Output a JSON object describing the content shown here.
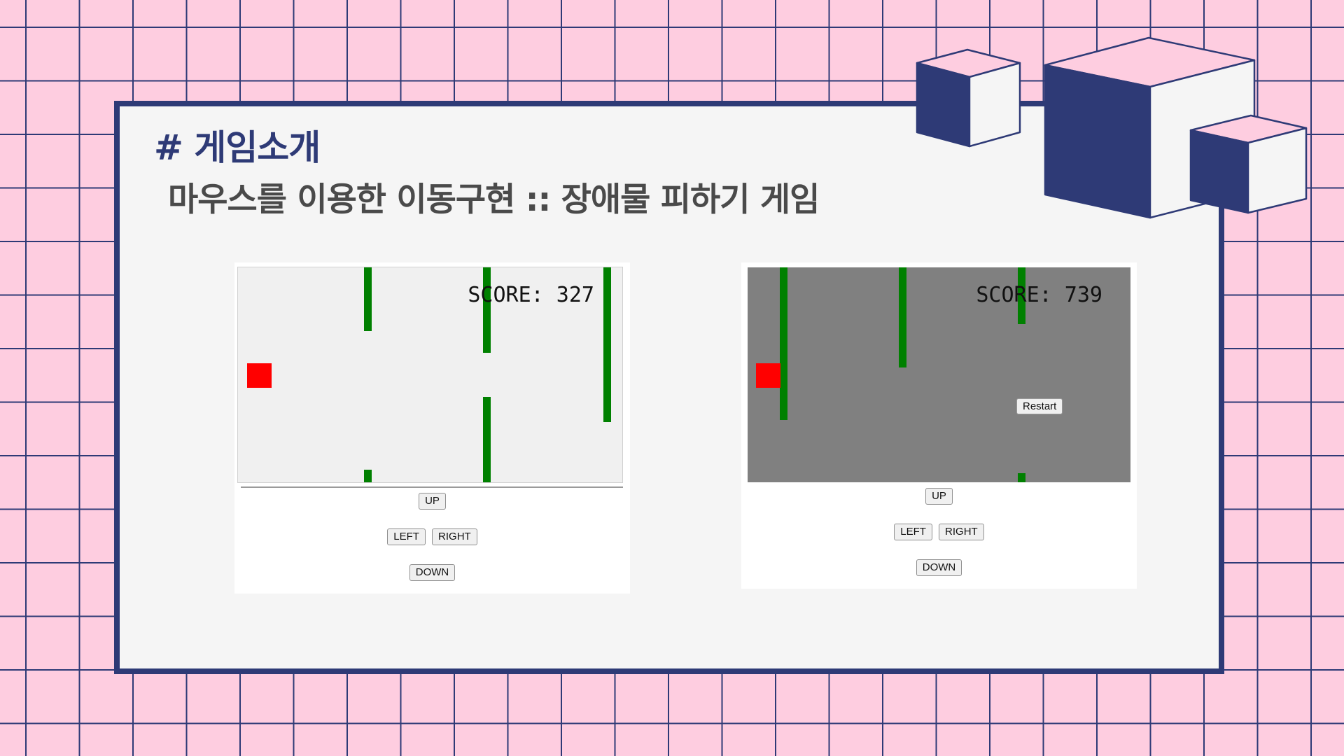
{
  "slide": {
    "title": "# 게임소개",
    "subtitle": "마우스를 이용한 이동구현 :: 장애물 피하기 게임"
  },
  "colors": {
    "background": "#FECDE0",
    "grid_line": "#2E3A76",
    "card": "#F5F5F5",
    "card_border": "#2E3A76",
    "title": "#2E3A76",
    "pillar": "#008000",
    "player": "#FF0000",
    "canvas_running": "#F0F0F0",
    "canvas_game_over": "#808080"
  },
  "decorations": [
    "cube-icon",
    "cube-icon",
    "cube-icon"
  ],
  "screenshots": [
    {
      "state": "running",
      "score_text": "SCORE: 327",
      "controls": {
        "up": "UP",
        "left": "LEFT",
        "right": "RIGHT",
        "down": "DOWN"
      }
    },
    {
      "state": "game-over",
      "score_text": "SCORE: 739",
      "restart_label": "Restart",
      "controls": {
        "up": "UP",
        "left": "LEFT",
        "right": "RIGHT",
        "down": "DOWN"
      }
    }
  ]
}
